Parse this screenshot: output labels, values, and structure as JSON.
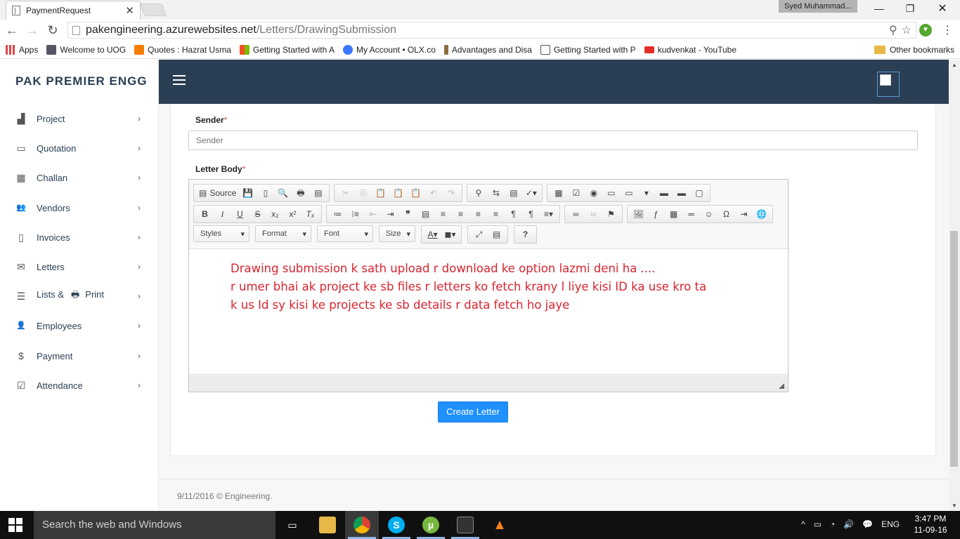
{
  "browser": {
    "tab_title": "PaymentRequest",
    "tab_close": "✕",
    "profile_name": "Syed Muhammad...",
    "window_controls": {
      "minimize": "—",
      "restore": "❐",
      "close": "✕"
    },
    "nav": {
      "back": "←",
      "forward": "→",
      "reload": "↻"
    },
    "url_host": "pakengineering.azurewebsites.net",
    "url_path": "/Letters/DrawingSubmission",
    "url_icons": {
      "zoom": "⚲",
      "star": "☆"
    },
    "menu": "⋮",
    "bookmarks": [
      {
        "label": "Apps",
        "color": "#d44"
      },
      {
        "label": "Welcome to UOG",
        "color": "#556"
      },
      {
        "label": "Quotes : Hazrat Usma",
        "color": "#f57d00"
      },
      {
        "label": "Getting Started with A",
        "color": "#2e7d32"
      },
      {
        "label": "My Account • OLX.co",
        "color": "#3a77ff"
      },
      {
        "label": "Advantages and Disa",
        "color": "#8a6d3b"
      },
      {
        "label": "Getting Started with P",
        "color": "#555"
      },
      {
        "label": "kudvenkat - YouTube",
        "color": "#e52d27"
      }
    ],
    "other_bookmarks": "Other bookmarks"
  },
  "app": {
    "brand": "PAK PREMIER ENGG",
    "sidebar": [
      {
        "label": "Project",
        "icon": "chart-icon",
        "glyph": "▟"
      },
      {
        "label": "Quotation",
        "icon": "clipboard-icon",
        "glyph": "▭"
      },
      {
        "label": "Challan",
        "icon": "calendar-icon",
        "glyph": "▦"
      },
      {
        "label": "Vendors",
        "icon": "users-icon",
        "glyph": "👥"
      },
      {
        "label": "Invoices",
        "icon": "file-icon",
        "glyph": "▯"
      },
      {
        "label": "Letters",
        "icon": "envelope-icon",
        "glyph": "✉"
      },
      {
        "label": "Lists &",
        "label2": "Print",
        "icon": "list-icon",
        "glyph": "☰"
      },
      {
        "label": "Employees",
        "icon": "user-plus-icon",
        "glyph": "👤"
      },
      {
        "label": "Payment",
        "icon": "dollar-icon",
        "glyph": "$"
      },
      {
        "label": "Attendance",
        "icon": "check-square-icon",
        "glyph": "☑"
      }
    ],
    "chevron": "›",
    "form": {
      "sender_label": "Sender",
      "sender_placeholder": "Sender",
      "body_label": "Letter Body",
      "required": "*",
      "body_lines": [
        "Drawing submission k sath upload r download ke option lazmi deni ha ....",
        "r umer bhai ak project ke sb files r letters ko fetch krany l liye kisi ID ka use kro ta",
        "k us Id sy kisi ke projects ke sb details r data fetch ho jaye"
      ],
      "submit_label": "Create Letter"
    },
    "editor": {
      "source_label": "Source",
      "combos": [
        "Styles",
        "Format",
        "Font",
        "Size"
      ],
      "help": "?"
    },
    "footer": "9/11/2016 © Engineering."
  },
  "taskbar": {
    "search_placeholder": "Search the web and Windows",
    "lang": "ENG",
    "time": "3:47 PM",
    "date": "11-09-16",
    "tray_icons": [
      "^",
      "▭",
      "◔",
      "🔊",
      "💬"
    ]
  }
}
